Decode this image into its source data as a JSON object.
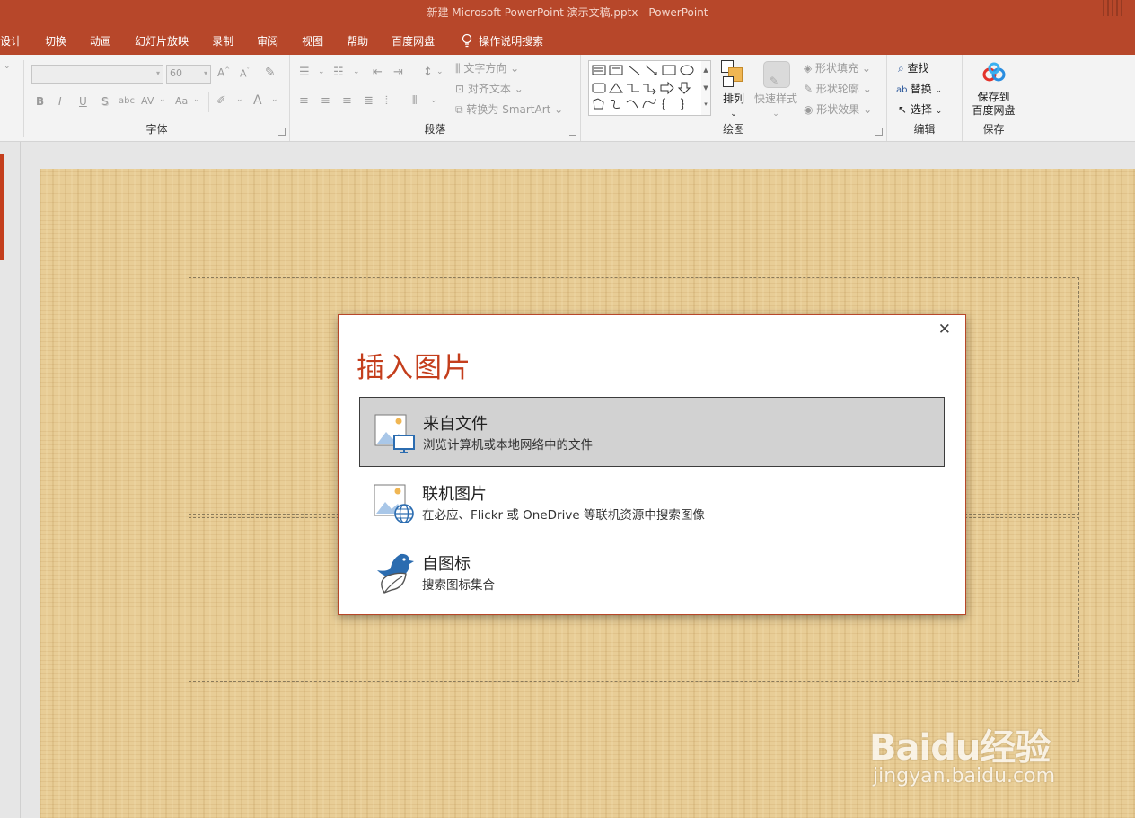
{
  "window": {
    "title": "新建 Microsoft PowerPoint 演示文稿.pptx  -  PowerPoint"
  },
  "menu": {
    "tabs": [
      "设计",
      "切换",
      "动画",
      "幻灯片放映",
      "录制",
      "审阅",
      "视图",
      "帮助",
      "百度网盘"
    ],
    "tell_me": "操作说明搜索"
  },
  "ribbon": {
    "font": {
      "label": "字体",
      "size_value": "60",
      "buttons": [
        "B",
        "I",
        "U",
        "S",
        "abc",
        "AV",
        "Aa",
        "A"
      ]
    },
    "paragraph": {
      "label": "段落",
      "text_direction": "文字方向",
      "align_text": "对齐文本",
      "smartart": "转换为 SmartArt"
    },
    "drawing": {
      "label": "绘图",
      "arrange": "排列",
      "quick_styles": "快速样式",
      "shape_fill": "形状填充",
      "shape_outline": "形状轮廓",
      "shape_effects": "形状效果"
    },
    "editing": {
      "label": "编辑",
      "find": "查找",
      "replace": "替换",
      "select": "选择"
    },
    "save": {
      "label": "保存",
      "button_line1": "保存到",
      "button_line2": "百度网盘"
    }
  },
  "dialog": {
    "title": "插入图片",
    "options": [
      {
        "title": "来自文件",
        "desc": "浏览计算机或本地网络中的文件",
        "icon": "picture-computer-icon",
        "selected": true
      },
      {
        "title": "联机图片",
        "desc": "在必应、Flickr 或 OneDrive 等联机资源中搜索图像",
        "icon": "picture-globe-icon",
        "selected": false
      },
      {
        "title": "自图标",
        "desc": "搜索图标集合",
        "icon": "bird-leaf-icon",
        "selected": false
      }
    ]
  },
  "watermark": {
    "main": "Baidu经验",
    "sub": "jingyan.baidu.com"
  },
  "colors": {
    "accent": "#b7472a",
    "dialog_title": "#c43e1c",
    "slide_background": "#e8cd96"
  }
}
